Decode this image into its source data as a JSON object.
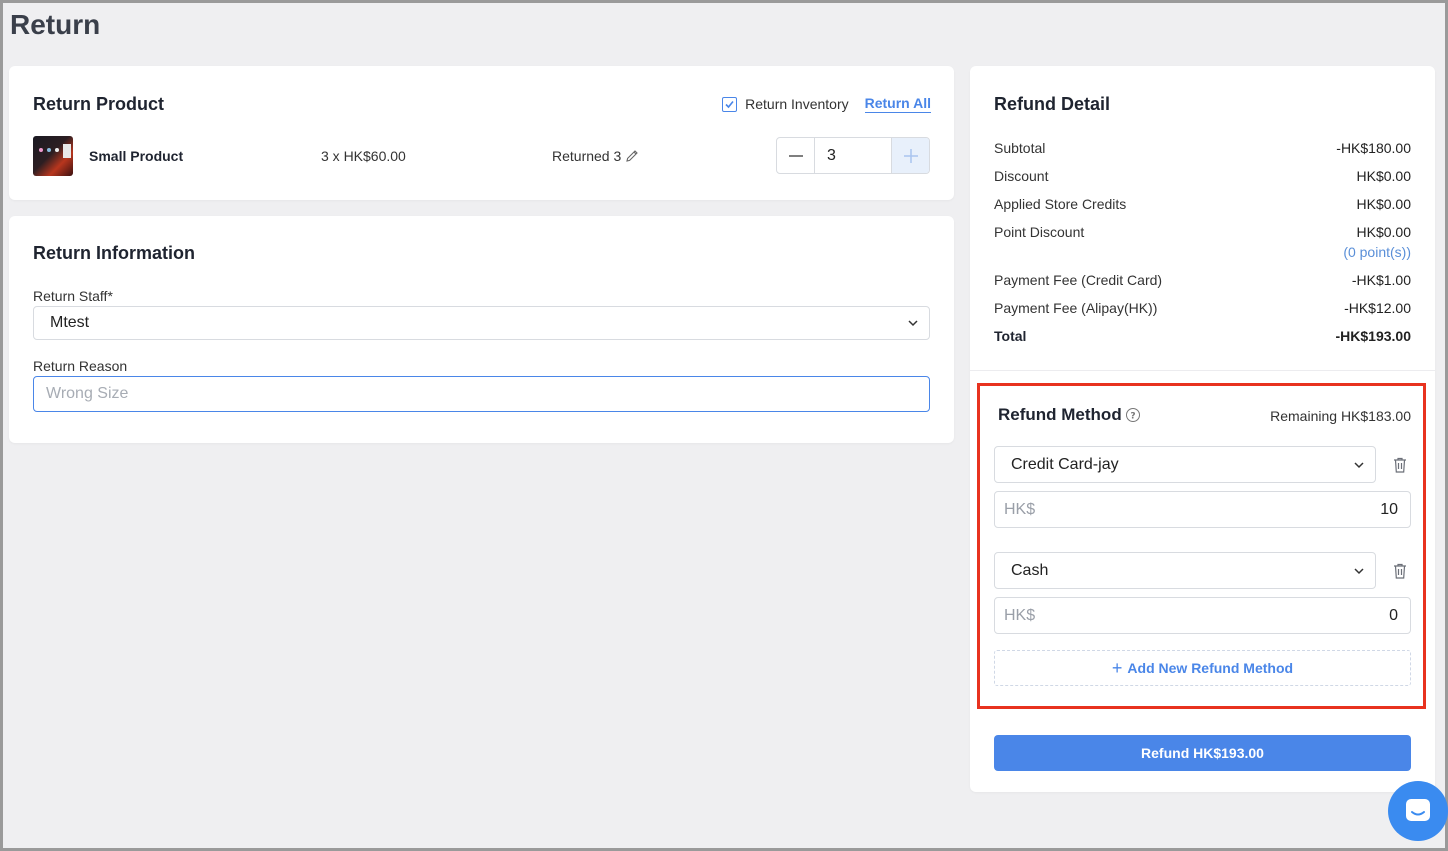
{
  "page": {
    "title": "Return"
  },
  "return_product": {
    "title": "Return Product",
    "return_inventory_label": "Return Inventory",
    "return_inventory_checked": true,
    "return_all_label": "Return All",
    "item": {
      "name": "Small Product",
      "price": "3 x HK$60.00",
      "returned": "Returned 3",
      "quantity": "3"
    }
  },
  "return_info": {
    "title": "Return Information",
    "staff_label": "Return Staff*",
    "staff_value": "Mtest",
    "reason_label": "Return Reason",
    "reason_placeholder": "Wrong Size"
  },
  "refund_detail": {
    "title": "Refund Detail",
    "rows": [
      {
        "label": "Subtotal",
        "value": "-HK$180.00"
      },
      {
        "label": "Discount",
        "value": "HK$0.00"
      },
      {
        "label": "Applied Store Credits",
        "value": "HK$0.00"
      },
      {
        "label": "Point Discount",
        "value": "HK$0.00"
      },
      {
        "label": "Payment Fee (Credit Card)",
        "value": "-HK$1.00"
      },
      {
        "label": "Payment Fee (Alipay(HK))",
        "value": "-HK$12.00"
      },
      {
        "label": "Total",
        "value": "-HK$193.00"
      }
    ],
    "point_note": "(0 point(s))"
  },
  "refund_method": {
    "title": "Refund Method",
    "remaining": "Remaining HK$183.00",
    "methods": [
      {
        "method": "Credit Card-jay",
        "currency": "HK$",
        "amount": "10"
      },
      {
        "method": "Cash",
        "currency": "HK$",
        "amount": "0"
      }
    ],
    "add_label": "Add New Refund Method"
  },
  "refund_button": {
    "label": "Refund HK$193.00"
  },
  "colors": {
    "accent": "#4a86e8",
    "highlight": "#e8321f",
    "background": "#efeff1"
  }
}
